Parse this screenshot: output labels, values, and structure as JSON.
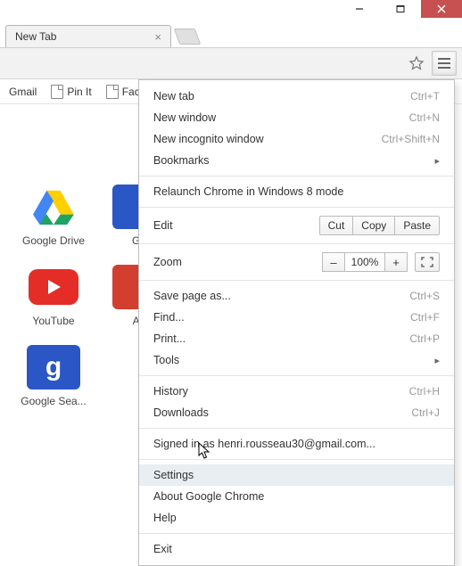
{
  "window": {
    "title": "New Tab"
  },
  "tab": {
    "label": "New Tab"
  },
  "bookmarks": {
    "items": [
      "Gmail",
      "Pin It",
      "Face"
    ]
  },
  "thumbs": {
    "r0c0": "Google Drive",
    "r0c1": "Go",
    "r1c0": "YouTube",
    "r1c1": "Au",
    "r2c0": "Google Sea..."
  },
  "menu": {
    "new_tab": {
      "label": "New tab",
      "shortcut": "Ctrl+T"
    },
    "new_window": {
      "label": "New window",
      "shortcut": "Ctrl+N"
    },
    "incognito": {
      "label": "New incognito window",
      "shortcut": "Ctrl+Shift+N"
    },
    "bookmarks": {
      "label": "Bookmarks"
    },
    "relaunch": {
      "label": "Relaunch Chrome in Windows 8 mode"
    },
    "edit": {
      "label": "Edit",
      "cut": "Cut",
      "copy": "Copy",
      "paste": "Paste"
    },
    "zoom": {
      "label": "Zoom",
      "level": "100%",
      "minus": "–",
      "plus": "+"
    },
    "save": {
      "label": "Save page as...",
      "shortcut": "Ctrl+S"
    },
    "find": {
      "label": "Find...",
      "shortcut": "Ctrl+F"
    },
    "print": {
      "label": "Print...",
      "shortcut": "Ctrl+P"
    },
    "tools": {
      "label": "Tools"
    },
    "history": {
      "label": "History",
      "shortcut": "Ctrl+H"
    },
    "downloads": {
      "label": "Downloads",
      "shortcut": "Ctrl+J"
    },
    "signedin": {
      "label": "Signed in as henri.rousseau30@gmail.com..."
    },
    "settings": {
      "label": "Settings"
    },
    "about": {
      "label": "About Google Chrome"
    },
    "help": {
      "label": "Help"
    },
    "exit": {
      "label": "Exit"
    }
  }
}
